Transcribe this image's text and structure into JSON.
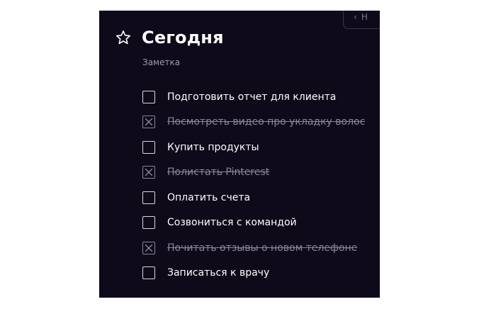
{
  "top_button": {
    "label": "Н",
    "icon": "chevron-left-icon"
  },
  "note": {
    "title": "Сегодня",
    "subtitle": "Заметка",
    "favorite_icon": "star-icon"
  },
  "tasks": [
    {
      "text": "Подготовить отчет для клиента",
      "done": false
    },
    {
      "text": "Посмотреть видео про укладку волос",
      "done": true
    },
    {
      "text": "Купить продукты",
      "done": false
    },
    {
      "text": "Полистать Pinterest",
      "done": true
    },
    {
      "text": "Оплатить счета",
      "done": false
    },
    {
      "text": "Созвониться с командой",
      "done": false
    },
    {
      "text": "Почитать отзывы о новом телефоне",
      "done": true
    },
    {
      "text": "Записаться к врачу",
      "done": false
    }
  ],
  "colors": {
    "panel_background": "#0f0a1a",
    "text_primary": "#ffffff",
    "text_done": "#8a8698",
    "subtitle": "#9c9aa8"
  }
}
